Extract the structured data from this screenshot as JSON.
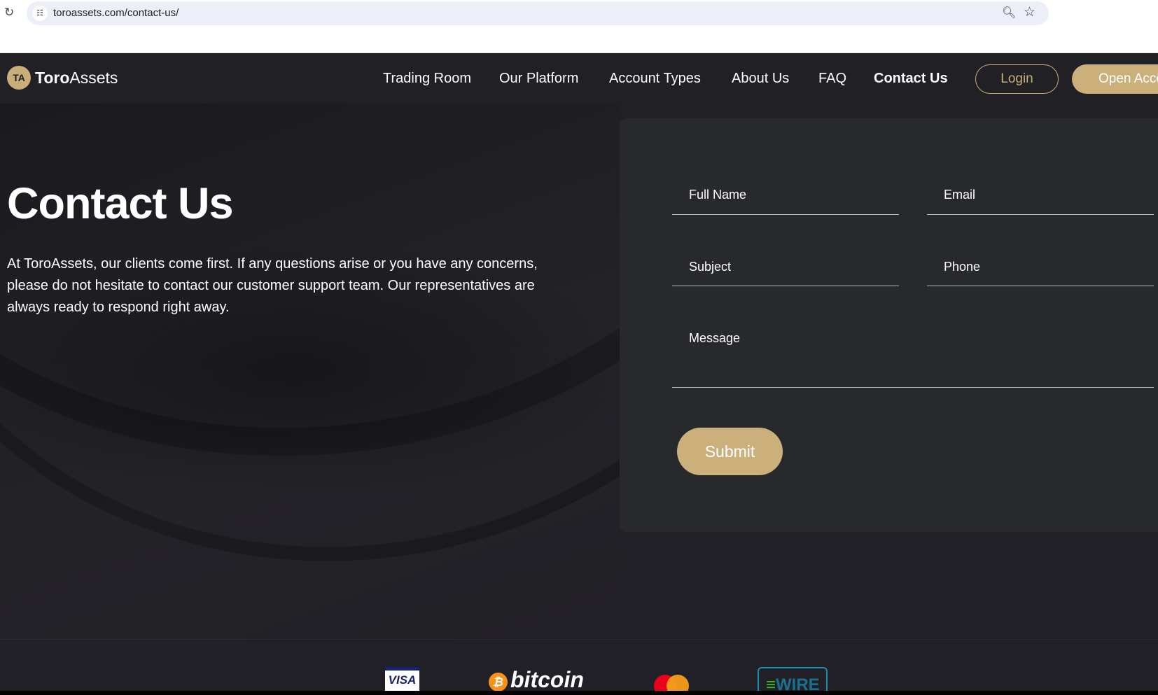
{
  "browser": {
    "url": "toroassets.com/contact-us/"
  },
  "nav": {
    "brand_bold": "Toro",
    "brand_light": "Assets",
    "logo_mark": "TA",
    "items": [
      "Trading Room",
      "Our Platform",
      "Account Types",
      "About Us",
      "FAQ",
      "Contact Us"
    ],
    "login": "Login",
    "open_account": "Open Account"
  },
  "hero": {
    "title": "Contact Us",
    "intro": "At ToroAssets, our clients come first. If any questions arise or you have any concerns, please do not hesitate to contact our customer support team. Our representatives are always ready to respond right away."
  },
  "form": {
    "full_name": "Full Name",
    "email": "Email",
    "subject": "Subject",
    "phone": "Phone",
    "message": "Message",
    "submit": "Submit"
  },
  "payments": {
    "visa": "VISA",
    "bitcoin": "bitcoin",
    "bitcoin_symbol": "₿",
    "wire": "WIRE"
  }
}
